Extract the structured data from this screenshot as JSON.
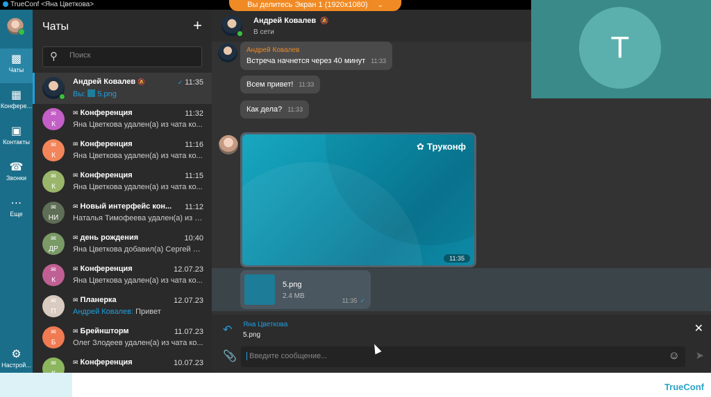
{
  "window": {
    "title": "TrueConf <Яна Цветкова>"
  },
  "share_banner": {
    "text": "Вы делитесь Экран 1 (1920x1080)"
  },
  "rail": {
    "items": [
      {
        "label": "Чаты",
        "icon": "chat-bubble-icon",
        "active": true
      },
      {
        "label": "Конфере...",
        "icon": "conference-icon",
        "active": false
      },
      {
        "label": "Контакты",
        "icon": "contacts-icon",
        "active": false
      },
      {
        "label": "Звонки",
        "icon": "phone-icon",
        "active": false
      },
      {
        "label": "Еще",
        "icon": "more-dots-icon",
        "active": false
      }
    ],
    "settings_label": "Настрой..."
  },
  "chats": {
    "title": "Чаты",
    "search_placeholder": "Поиск",
    "items": [
      {
        "name": "Андрей Ковалев",
        "time": "11:35",
        "prefix": "Вы:",
        "preview": "5.png",
        "active": true,
        "muted": true,
        "photo": true
      },
      {
        "name": "Конференция",
        "time": "11:32",
        "preview": "Яна Цветкова удален(а) из чата ко...",
        "initials": "К",
        "color": "#c35fc6"
      },
      {
        "name": "Конференция",
        "time": "11:16",
        "preview": "Яна Цветкова удален(а) из чата ко...",
        "initials": "К",
        "color": "#f2855a"
      },
      {
        "name": "Конференция",
        "time": "11:15",
        "preview": "Яна Цветкова удален(а) из чата ко...",
        "initials": "К",
        "color": "#9ab66a"
      },
      {
        "name": "Новый интерфейс кон...",
        "time": "11:12",
        "preview": "Наталья Тимофеева удален(а) из ч...",
        "initials": "НИ",
        "color": "#5f6e56"
      },
      {
        "name": "день рождения",
        "time": "10:40",
        "preview": "Яна Цветкова добавил(а) Сергей П...",
        "initials": "ДР",
        "color": "#7a9a66"
      },
      {
        "name": "Конференция",
        "time": "12.07.23",
        "preview": "Яна Цветкова удален(а) из чата ко...",
        "initials": "К",
        "color": "#c05f93"
      },
      {
        "name": "Планерка",
        "time": "12.07.23",
        "prefix": "Андрей Ковалев:",
        "preview": "Привет",
        "initials": "П",
        "color": "#d9cbc0"
      },
      {
        "name": "Брейншторм",
        "time": "11.07.23",
        "preview": "Олег Злодеев удален(а) из чата ко...",
        "initials": "Б",
        "color": "#f07a52"
      },
      {
        "name": "Конференция",
        "time": "10.07.23",
        "preview": "",
        "initials": "К",
        "color": "#8cb65e"
      }
    ]
  },
  "chat": {
    "contact": "Андрей Ковалев",
    "status": "В сети",
    "messages": [
      {
        "sender": "Андрей Ковалев",
        "text": "Встреча начнется через 40 минут",
        "time": "11:33"
      },
      {
        "text": "Всем привет!",
        "time": "11:33"
      },
      {
        "text": "Как дела?",
        "time": "11:33"
      }
    ],
    "image": {
      "brand": "Труконф",
      "time": "11:35"
    },
    "file": {
      "name": "5.png",
      "size": "2.4 MB",
      "time": "11:35"
    },
    "reply": {
      "name": "Яна Цветкова",
      "text": "5.png"
    },
    "composer_placeholder": "Введите сообщение..."
  },
  "video": {
    "letter": "T"
  },
  "footer": {
    "brand": "TrueConf"
  },
  "colors": {
    "accent": "#1fa0e0",
    "share_orange": "#f08a24",
    "rail": "#1a6e8a"
  }
}
